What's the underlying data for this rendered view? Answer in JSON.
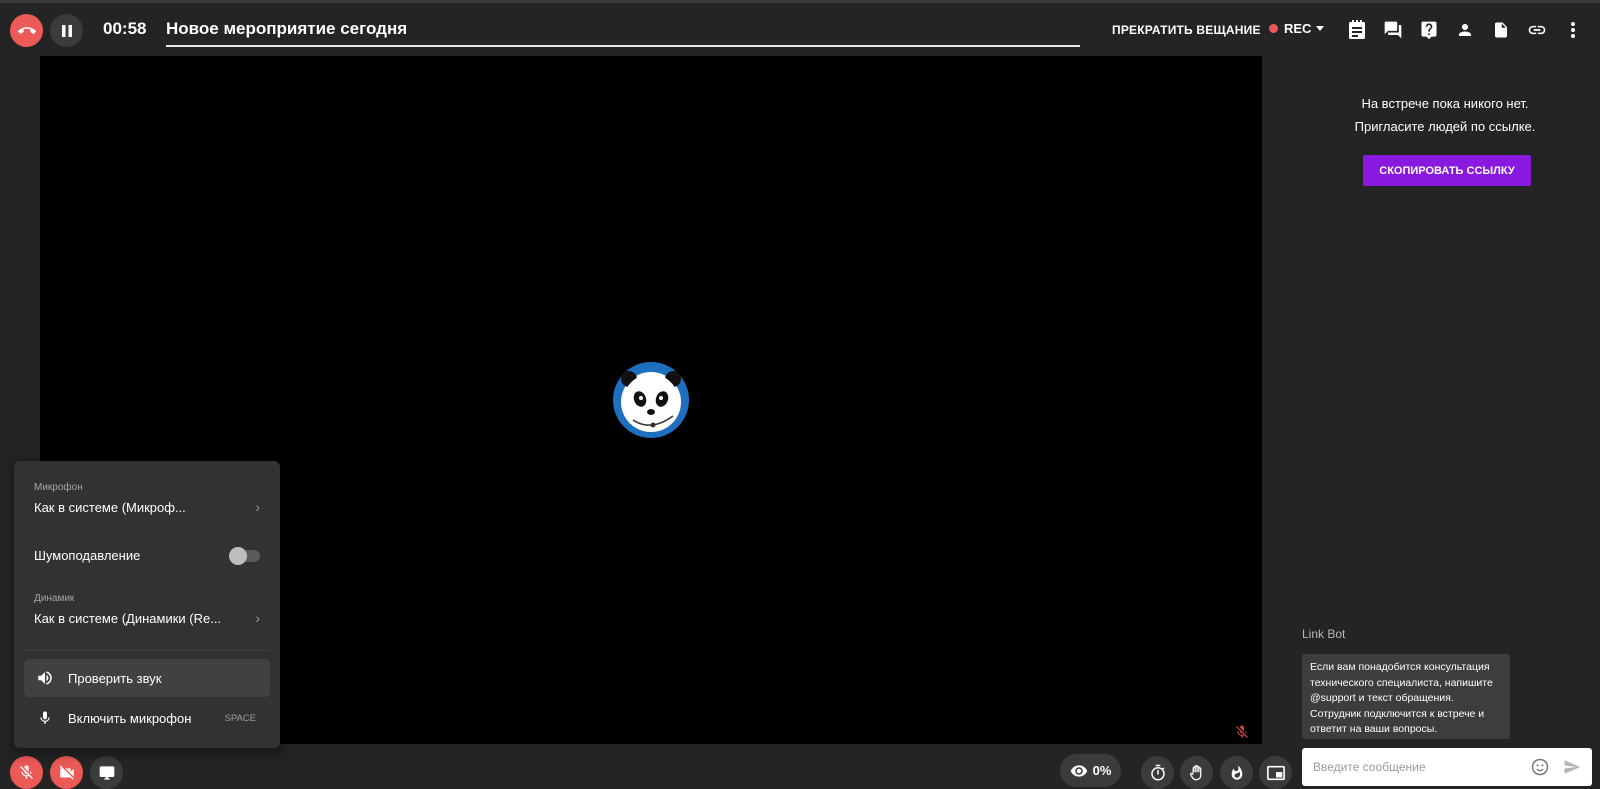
{
  "header": {
    "timer": "00:58",
    "title": "Новое мероприятие сегодня",
    "stop_broadcast_label": "ПРЕКРАТИТЬ ВЕЩАНИЕ",
    "rec_label": "REC"
  },
  "right_panel": {
    "empty_line1": "На встрече пока никого нет.",
    "empty_line2": "Пригласите людей по ссылке.",
    "copy_link_label": "СКОПИРОВАТЬ ССЫЛКУ",
    "bot_name": "Link Bot",
    "bot_message": "Если вам понадобится консультация технического специалиста, напишите @support и текст обращения. Сотрудник подключится к встрече и ответит на ваши вопросы.",
    "input_placeholder": "Введите сообщение"
  },
  "audio_menu": {
    "mic_label": "Микрофон",
    "mic_value": "Как в системе (Микроф...",
    "noise_label": "Шумоподавление",
    "noise_enabled": false,
    "speaker_label": "Динамик",
    "speaker_value": "Как в системе (Динамики (Re...",
    "check_sound_label": "Проверить звук",
    "enable_mic_label": "Включить микрофон",
    "enable_mic_shortcut": "SPACE"
  },
  "bottom_bar": {
    "viewers_percent": "0%"
  },
  "colors": {
    "background": "#242424",
    "accent_red": "#ec5a57",
    "accent_purple": "#8a19e0",
    "stage": "#000000"
  },
  "icons": {
    "header_left": [
      "hangup-icon",
      "pause-icon"
    ],
    "header_right": [
      "notes-icon",
      "chat-icon",
      "help-icon",
      "person-icon",
      "document-icon",
      "link-icon",
      "more-icon"
    ],
    "bottom_left": [
      "mic-off-icon",
      "camera-off-icon",
      "screen-share-icon"
    ],
    "bottom_right": [
      "eye-icon",
      "timer-icon",
      "raise-hand-icon",
      "fire-icon",
      "layout-icon"
    ]
  }
}
